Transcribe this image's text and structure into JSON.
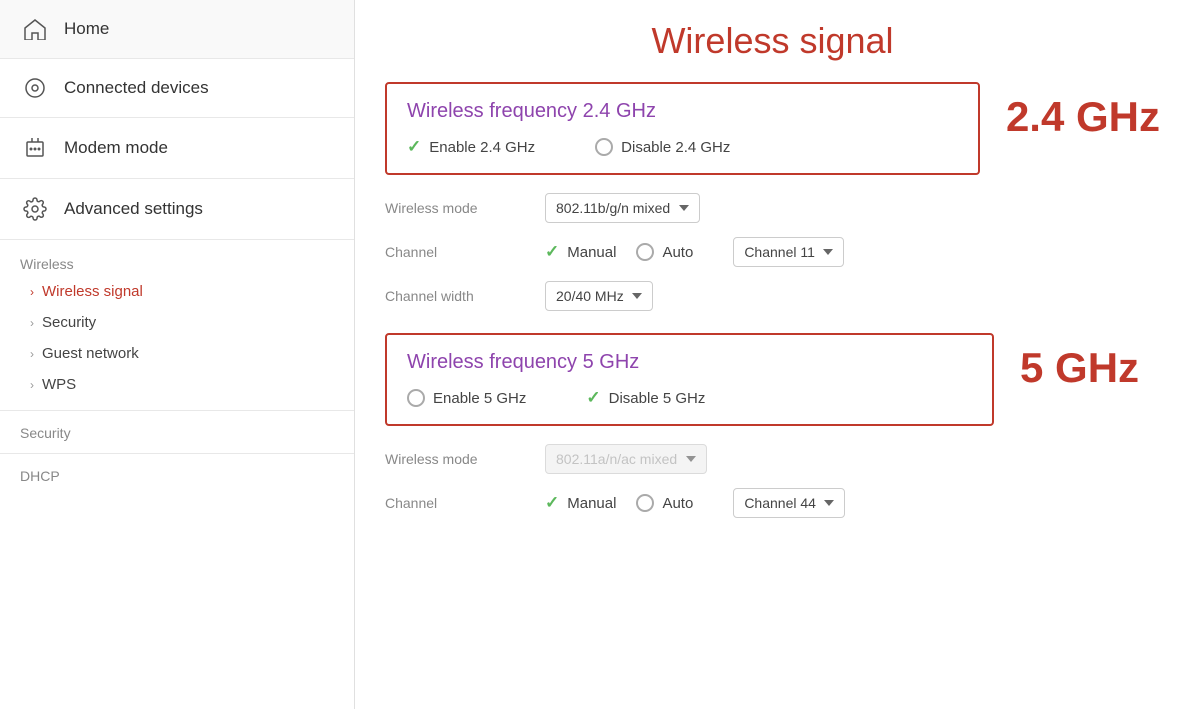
{
  "sidebar": {
    "items": [
      {
        "id": "home",
        "label": "Home",
        "icon": "home"
      },
      {
        "id": "connected-devices",
        "label": "Connected devices",
        "icon": "devices"
      },
      {
        "id": "modem-mode",
        "label": "Modem mode",
        "icon": "modem"
      },
      {
        "id": "advanced-settings",
        "label": "Advanced settings",
        "icon": "gear"
      }
    ],
    "submenu": {
      "wireless_label": "Wireless",
      "wireless_items": [
        {
          "id": "wireless-signal",
          "label": "Wireless signal",
          "active": true
        },
        {
          "id": "security",
          "label": "Security",
          "active": false
        },
        {
          "id": "guest-network",
          "label": "Guest network",
          "active": false
        },
        {
          "id": "wps",
          "label": "WPS",
          "active": false
        }
      ],
      "security_label": "Security",
      "dhcp_label": "DHCP"
    }
  },
  "main": {
    "page_title": "Wireless signal",
    "freq_24": {
      "title": "Wireless frequency 2.4 GHz",
      "enable_label": "Enable 2.4 GHz",
      "disable_label": "Disable 2.4 GHz",
      "enable_checked": true,
      "disable_checked": false
    },
    "freq_24_settings": {
      "wireless_mode_label": "Wireless mode",
      "wireless_mode_value": "802.11b/g/n mixed",
      "channel_label": "Channel",
      "channel_manual_label": "Manual",
      "channel_auto_label": "Auto",
      "channel_manual_checked": true,
      "channel_auto_checked": false,
      "channel_value": "Channel 11",
      "channel_width_label": "Channel width",
      "channel_width_value": "20/40 MHz"
    },
    "side_label_24": "2.4 GHz",
    "freq_5": {
      "title": "Wireless frequency 5 GHz",
      "enable_label": "Enable 5 GHz",
      "disable_label": "Disable 5 GHz",
      "enable_checked": false,
      "disable_checked": true
    },
    "side_label_5": "5 GHz",
    "freq_5_settings": {
      "wireless_mode_label": "Wireless mode",
      "wireless_mode_value": "802.11a/n/ac mixed",
      "channel_label": "Channel",
      "channel_manual_label": "Manual",
      "channel_auto_label": "Auto",
      "channel_value": "Channel 44"
    }
  }
}
